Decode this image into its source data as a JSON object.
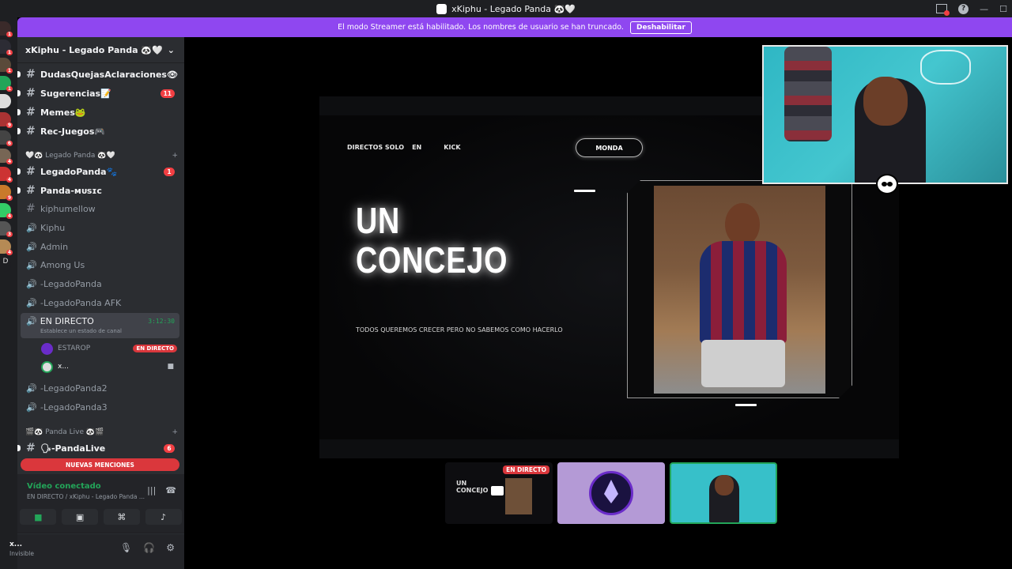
{
  "window": {
    "title": "xKiphu - Legado Panda 🐼🤍"
  },
  "banner": {
    "text": "El modo Streamer está habilitado. Los nombres de usuario se han truncado.",
    "button": "Deshabilitar"
  },
  "server_rail": {
    "badges": [
      "1",
      "1",
      "1",
      "1",
      "9",
      "6",
      "4",
      "4",
      "9",
      "4",
      "3",
      "4"
    ],
    "last_label": "D"
  },
  "sidebar": {
    "guild_name": "xKiphu - Legado Panda 🐼🤍",
    "channels_top": [
      {
        "name": "DudasQuejasAclaraciones👁",
        "badge": ""
      },
      {
        "name": "Sugerencias📝",
        "badge": "11"
      },
      {
        "name": "Memes🐸",
        "badge": ""
      },
      {
        "name": "Rec-Juegos🎮",
        "badge": ""
      }
    ],
    "category_1": "🤍🐼 Legado Panda 🐼🤍",
    "channels_mid": [
      {
        "name": "LegadoPanda🐾",
        "badge": "1",
        "type": "text",
        "bold": true
      },
      {
        "name": "Panda-ᴍᴜsɪᴄ",
        "badge": "",
        "type": "text",
        "bold": true
      },
      {
        "name": "kiphumellow",
        "badge": "",
        "type": "text",
        "bold": false
      },
      {
        "name": "Kiphu",
        "badge": "",
        "type": "voice",
        "bold": false
      },
      {
        "name": "Admin",
        "badge": "",
        "type": "voice",
        "bold": false
      },
      {
        "name": "Among Us",
        "badge": "",
        "type": "voice",
        "bold": false
      },
      {
        "name": "-LegadoPanda",
        "badge": "",
        "type": "voice",
        "bold": false
      },
      {
        "name": "-LegadoPanda AFK",
        "badge": "",
        "type": "voice",
        "bold": false
      }
    ],
    "live_channel": {
      "name": "EN DIRECTO",
      "status": "Establece un estado de canal",
      "timer": "3:12:30"
    },
    "members": [
      {
        "name": "ESTAROP",
        "badge": "EN DIRECTO"
      },
      {
        "name": "x...",
        "badge": ""
      }
    ],
    "channels_after": [
      {
        "name": "-LegadoPanda2"
      },
      {
        "name": "-LegadoPanda3"
      }
    ],
    "category_2": "🎬🐼 Panda Live 🐼🎬",
    "panda_live": {
      "name": "🗣-PandaLive",
      "badge": "6"
    },
    "mentions_label": "NUEVAS MENCIONES"
  },
  "voice_panel": {
    "status": "Vídeo conectado",
    "location": "EN DIRECTO / xKiphu - Legado Panda ..."
  },
  "user_panel": {
    "name": "x...",
    "status": "Invisible"
  },
  "stream": {
    "nav": [
      "DIRECTOS SOLO",
      "EN",
      "KICK"
    ],
    "pill": "MONDA",
    "headline_1": "UN",
    "headline_2": "CONCEJO",
    "tagline": "TODOS QUEREMOS CRECER PERO NO SABEMOS COMO HACERLO"
  },
  "tiles": {
    "live_tag": "EN DIRECTO",
    "mini_text_1": "UN",
    "mini_text_2": "CONCEJO"
  }
}
